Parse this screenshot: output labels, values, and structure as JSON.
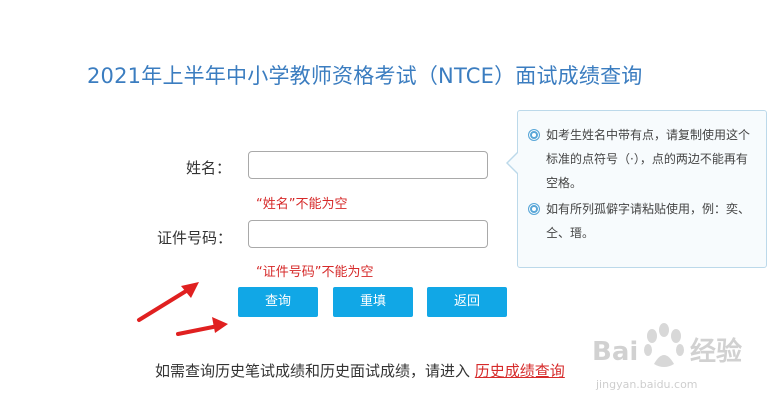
{
  "title": "2021年上半年中小学教师资格考试（NTCE）面试成绩查询",
  "form": {
    "name_label": "姓名：",
    "name_value": "",
    "name_error": "“姓名”不能为空",
    "id_label": "证件号码：",
    "id_value": "",
    "id_error": "“证件号码”不能为空"
  },
  "buttons": {
    "query": "查询",
    "reset": "重填",
    "back": "返回"
  },
  "tips": [
    "如考生姓名中带有点，请复制使用这个标准的点符号（·），点的两边不能再有空格。",
    "如有所列孤僻字请粘贴使用，例：奕、仝、瑨。"
  ],
  "footer": {
    "text": "如需查询历史笔试成绩和历史面试成绩，请进入",
    "link": "历史成绩查询"
  },
  "watermark": {
    "brand": "Baidu经验",
    "url": "jingyan.baidu.com"
  },
  "colors": {
    "title": "#3b7dc0",
    "button": "#11a7e6",
    "error": "#d62a2a",
    "annotation_arrow": "#e02020"
  }
}
